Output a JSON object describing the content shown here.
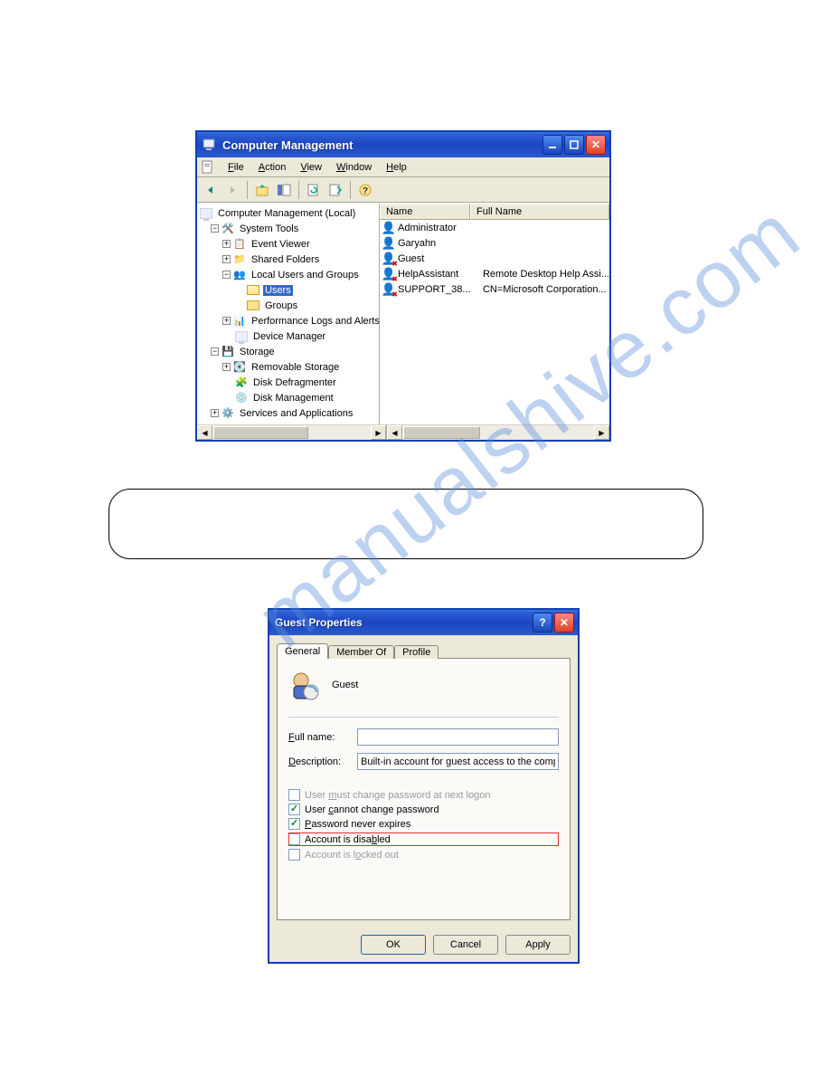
{
  "watermark": "manualshive.com",
  "mgmt": {
    "title": "Computer Management",
    "menus": {
      "file": "File",
      "action": "Action",
      "view": "View",
      "window": "Window",
      "help": "Help"
    },
    "tree": {
      "root": "Computer Management (Local)",
      "systools": "System Tools",
      "event": "Event Viewer",
      "shared": "Shared Folders",
      "localusers": "Local Users and Groups",
      "users": "Users",
      "groups": "Groups",
      "perf": "Performance Logs and Alerts",
      "devmgr": "Device Manager",
      "storage": "Storage",
      "remstor": "Removable Storage",
      "defrag": "Disk Defragmenter",
      "diskmgmt": "Disk Management",
      "services": "Services and Applications"
    },
    "cols": {
      "name": "Name",
      "fullname": "Full Name"
    },
    "rows": [
      {
        "name": "Administrator",
        "fullname": ""
      },
      {
        "name": "Garyahn",
        "fullname": ""
      },
      {
        "name": "Guest",
        "fullname": ""
      },
      {
        "name": "HelpAssistant",
        "fullname": "Remote Desktop Help Assi..."
      },
      {
        "name": "SUPPORT_38...",
        "fullname": "CN=Microsoft Corporation..."
      }
    ]
  },
  "props": {
    "title": "Guest Properties",
    "tabs": {
      "general": "General",
      "memberof": "Member Of",
      "profile": "Profile"
    },
    "header": "Guest",
    "fullname_label": "Full name:",
    "fullname_value": "",
    "description_label": "Description:",
    "description_value": "Built-in account for guest access to the computer/d",
    "cb_mustchange": "User must change password at next logon",
    "cb_cannotchange": "User cannot change password",
    "cb_neverexp": "Password never expires",
    "cb_disabled": "Account is disabled",
    "cb_locked": "Account is locked out",
    "buttons": {
      "ok": "OK",
      "cancel": "Cancel",
      "apply": "Apply"
    }
  }
}
